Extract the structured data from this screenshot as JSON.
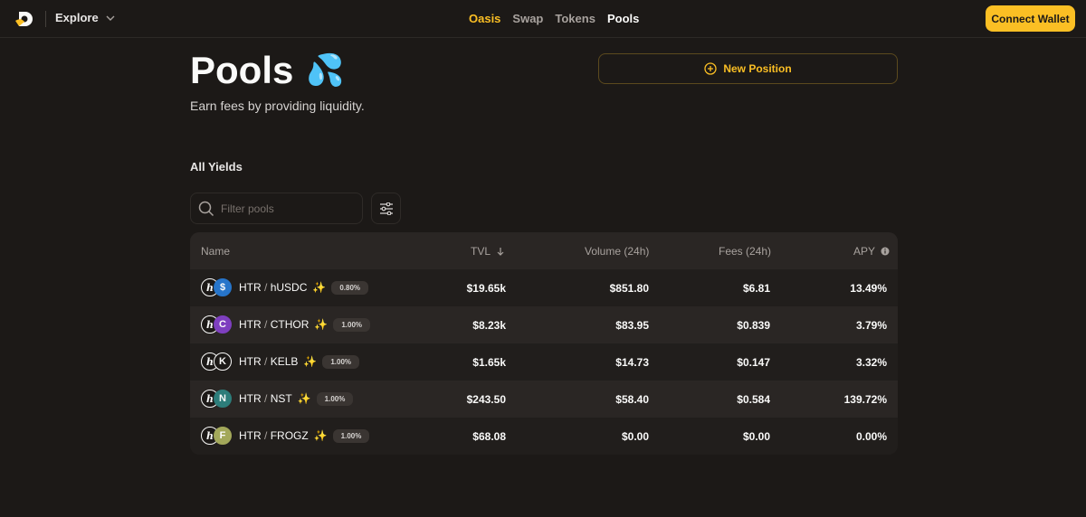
{
  "header": {
    "explore_label": "Explore",
    "nav": {
      "oasis": "Oasis",
      "swap": "Swap",
      "tokens": "Tokens",
      "pools": "Pools"
    },
    "connect_label": "Connect Wallet"
  },
  "page": {
    "title": "Pools",
    "title_emoji": "💦",
    "subtitle": "Earn fees by providing liquidity.",
    "new_position_label": "New Position",
    "section_label": "All Yields",
    "search_placeholder": "Filter pools"
  },
  "table": {
    "columns": {
      "name": "Name",
      "tvl": "TVL",
      "volume": "Volume (24h)",
      "fees": "Fees (24h)",
      "apy": "APY"
    },
    "rows": [
      {
        "base": "HTR",
        "quote": "hUSDC",
        "fee": "0.80%",
        "tvl": "$19.65k",
        "volume": "$851.80",
        "fees": "$6.81",
        "apy": "13.49%",
        "token_color": "#2775ca",
        "token_glyph": "$"
      },
      {
        "base": "HTR",
        "quote": "CTHOR",
        "fee": "1.00%",
        "tvl": "$8.23k",
        "volume": "$83.95",
        "fees": "$0.839",
        "apy": "3.79%",
        "token_color": "#7e3fbf",
        "token_glyph": "C"
      },
      {
        "base": "HTR",
        "quote": "KELB",
        "fee": "1.00%",
        "tvl": "$1.65k",
        "volume": "$14.73",
        "fees": "$0.147",
        "apy": "3.32%",
        "token_color": "#1c1917",
        "token_glyph": "K"
      },
      {
        "base": "HTR",
        "quote": "NST",
        "fee": "1.00%",
        "tvl": "$243.50",
        "volume": "$58.40",
        "fees": "$0.584",
        "apy": "139.72%",
        "token_color": "#2d7d7a",
        "token_glyph": "N"
      },
      {
        "base": "HTR",
        "quote": "FROGZ",
        "fee": "1.00%",
        "tvl": "$68.08",
        "volume": "$0.00",
        "fees": "$0.00",
        "apy": "0.00%",
        "token_color": "#a3a85a",
        "token_glyph": "F"
      }
    ]
  },
  "colors": {
    "accent": "#fbbf24",
    "background": "#1c1917"
  }
}
